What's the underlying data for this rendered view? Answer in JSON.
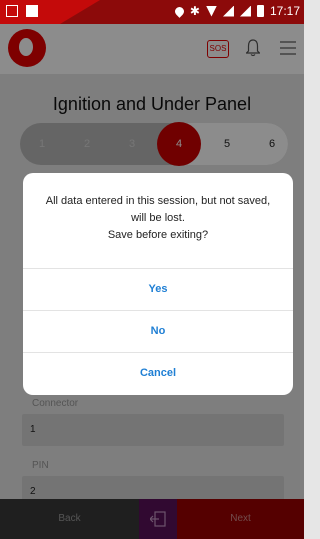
{
  "status_bar": {
    "time": "17:17",
    "icons": [
      "screenshot-icon",
      "square-icon",
      "location-icon",
      "bluetooth-icon",
      "wifi-icon",
      "signal-icon",
      "battery-icon"
    ]
  },
  "header": {
    "logo": "vodafone-logo",
    "sos_label": "SOS",
    "icons": [
      "bell-icon",
      "menu-icon"
    ],
    "brand_color": "#e60000"
  },
  "page": {
    "title": "Ignition and Under Panel",
    "steps": [
      "1",
      "2",
      "3",
      "4",
      "5",
      "6"
    ],
    "active_step": "4"
  },
  "form": {
    "connector_label": "Connector",
    "connector_value": "1",
    "pin_label": "PIN",
    "pin_value": "2"
  },
  "footer": {
    "back_label": "Back",
    "exit_icon": "exit-icon",
    "next_label": "Next"
  },
  "dialog": {
    "line1": "All data entered in this session, but not saved,",
    "line2": "will be lost.",
    "line3": "Save before exiting?",
    "yes_label": "Yes",
    "no_label": "No",
    "cancel_label": "Cancel",
    "button_color": "#1f7fd4"
  }
}
